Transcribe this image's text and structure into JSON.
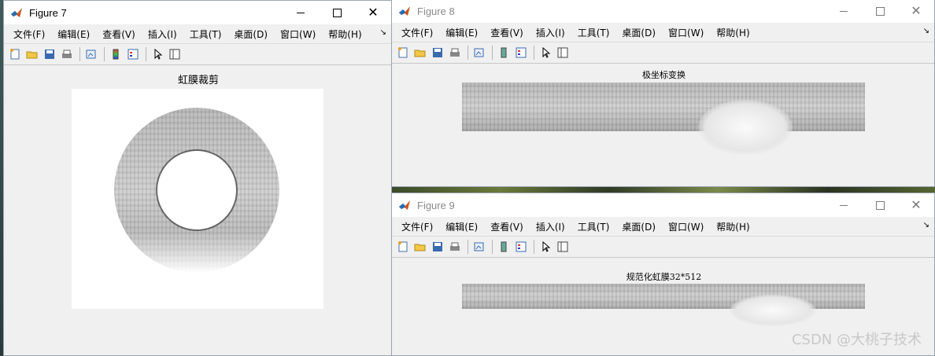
{
  "windows": [
    {
      "id": "figure7",
      "title": "Figure 7",
      "active": true,
      "menu": [
        "文件(F)",
        "编辑(E)",
        "查看(V)",
        "插入(I)",
        "工具(T)",
        "桌面(D)",
        "窗口(W)",
        "帮助(H)"
      ],
      "axes_title": "虹膜裁剪"
    },
    {
      "id": "figure8",
      "title": "Figure 8",
      "active": false,
      "menu": [
        "文件(F)",
        "编辑(E)",
        "查看(V)",
        "插入(I)",
        "工具(T)",
        "桌面(D)",
        "窗口(W)",
        "帮助(H)"
      ],
      "axes_title": "极坐标变换"
    },
    {
      "id": "figure9",
      "title": "Figure 9",
      "active": false,
      "menu": [
        "文件(F)",
        "编辑(E)",
        "查看(V)",
        "插入(I)",
        "工具(T)",
        "桌面(D)",
        "窗口(W)",
        "帮助(H)"
      ],
      "axes_title": "规范化虹膜32*512"
    }
  ],
  "toolbar_icons": [
    "new-figure-icon",
    "open-file-icon",
    "save-icon",
    "print-icon",
    "link-plot-icon",
    "insert-colorbar-icon",
    "insert-legend-icon",
    "edit-plot-arrow-icon",
    "property-inspector-icon"
  ],
  "window_controls": {
    "minimize": "─",
    "maximize": "□",
    "close": "✕"
  },
  "menu_overflow": "↘",
  "watermark": "CSDN @大桃子技术"
}
